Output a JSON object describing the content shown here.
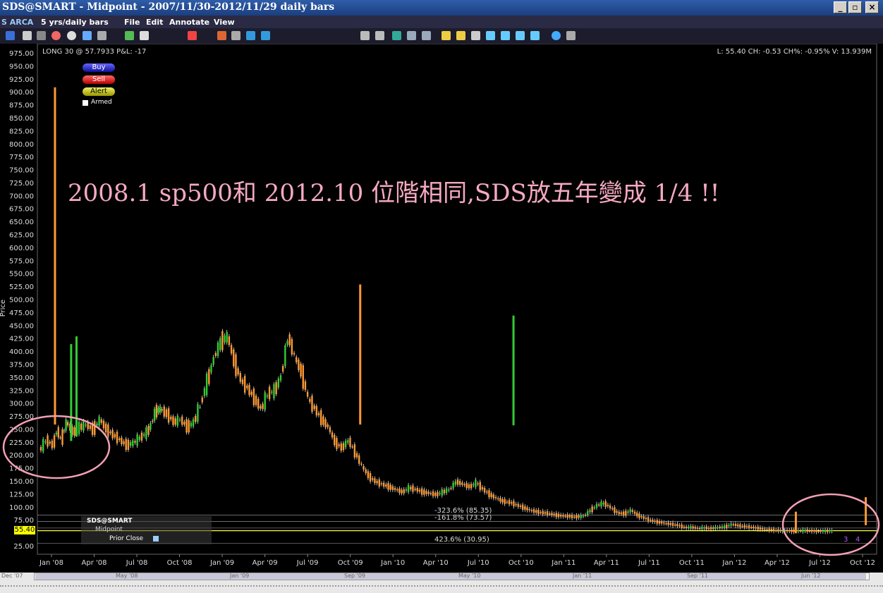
{
  "window": {
    "title": "SDS@SMART - Midpoint - 2007/11/30-2012/11/29 daily bars"
  },
  "menu": {
    "exchange": "S ARCA",
    "period": "5 yrs/daily bars",
    "items": [
      "File",
      "Edit",
      "Annotate",
      "View"
    ]
  },
  "header": {
    "position": "LONG 30 @ 57.7933 P&L: -17",
    "stats": "L: 55.40 CH: -0.53 CH%: -0.95% V: 13.939M"
  },
  "order_panel": {
    "buy": "Buy",
    "sell": "Sell",
    "alert": "Alert",
    "armed": "Armed"
  },
  "annotation": "2008.1 sp500和 2012.10 位階相同,SDS放五年變成 1/4 !!",
  "legend": {
    "symbol": "SDS@SMART",
    "midpoint": "Midpoint",
    "prior_close": "Prior Close"
  },
  "price_tag": "55.40",
  "fib_labels": [
    "-323.6% (85.35)",
    "-161.8% (73.57)",
    "423.6% (30.95)"
  ],
  "wave_labels": [
    "3",
    "4"
  ],
  "scroll_labels": [
    "Dec '07",
    "May '08",
    "Jan '09",
    "Sep '09",
    "May '10",
    "Jan '11",
    "Sep '11",
    "Jun '12"
  ],
  "colors": {
    "up": "#33cc33",
    "down": "#ff9933",
    "wick": "#ffffff",
    "circle": "#f2a0b4",
    "annotation": "#f5a9c0",
    "price_tag": "#ffff00"
  },
  "chart_data": {
    "type": "bar",
    "title": "SDS@SMART - Midpoint - 2007/11/30-2012/11/29 daily bars",
    "ylabel": "Price",
    "ylim": [
      25,
      975
    ],
    "yticks": [
      975,
      950,
      925,
      900,
      875,
      850,
      825,
      800,
      775,
      750,
      725,
      700,
      675,
      650,
      625,
      600,
      575,
      550,
      525,
      500,
      475,
      450,
      425,
      400,
      375,
      350,
      325,
      300,
      275,
      250,
      225,
      200,
      175,
      150,
      125,
      100,
      75,
      55.4,
      25
    ],
    "xtick_labels": [
      "Jan '08",
      "Apr '08",
      "Jul '08",
      "Oct '08",
      "Jan '09",
      "Apr '09",
      "Jul '09",
      "Oct '09",
      "Jan '10",
      "Apr '10",
      "Jul '10",
      "Oct '10",
      "Jan '11",
      "Apr '11",
      "Jul '11",
      "Oct '11",
      "Jan '12",
      "Apr '12",
      "Jul '12",
      "Oct '12"
    ],
    "x": [
      0,
      0.5,
      1,
      1.3,
      1.6,
      2,
      2.5,
      3,
      3.5,
      4,
      4.5,
      5,
      5.5,
      6,
      6.5,
      7,
      7.5,
      8,
      8.3,
      8.6,
      9,
      9.5,
      10,
      10.5,
      11,
      11.5,
      12,
      12.5,
      13,
      13.5,
      14,
      14.5,
      15,
      15.5,
      16,
      16.5,
      17,
      17.5,
      18,
      18.5,
      19,
      19.5,
      20,
      20.5,
      21,
      21.5,
      22,
      22.5,
      23,
      23.5,
      24,
      24.5,
      25,
      25.5,
      26,
      26.5,
      27,
      27.5,
      28,
      28.5,
      29,
      29.5,
      30,
      30.5,
      31,
      31.5,
      32,
      32.5,
      33,
      33.5,
      34,
      34.5,
      35,
      35.5,
      36,
      36.5,
      37,
      37.5,
      38,
      38.5,
      39,
      39.5,
      40,
      40.5,
      41,
      41.5,
      42,
      42.5,
      43,
      43.5,
      44,
      44.5,
      45,
      45.5,
      46,
      46.5,
      47,
      47.5,
      48,
      48.5,
      49,
      49.5,
      50,
      50.5,
      51,
      51.5,
      52,
      52.5,
      53,
      53.5,
      54,
      54.5,
      55,
      55.5,
      56,
      56.5,
      57,
      57.5,
      58,
      58.5,
      59,
      59.5,
      60
    ],
    "series": [
      {
        "values": [
          210,
          230,
          220,
          250,
          230,
          265,
          245,
          255,
          260,
          250,
          270,
          250,
          240,
          230,
          220,
          225,
          235,
          245,
          260,
          285,
          290,
          280,
          265,
          270,
          255,
          265,
          300,
          345,
          390,
          420,
          430,
          380,
          345,
          330,
          310,
          290,
          320,
          325,
          355,
          430,
          390,
          360,
          310,
          290,
          270,
          255,
          225,
          215,
          230,
          205,
          180,
          160,
          150,
          145,
          140,
          135,
          130,
          138,
          135,
          130,
          128,
          125,
          130,
          135,
          150,
          145,
          140,
          148,
          135,
          125,
          118,
          112,
          110,
          105,
          100,
          95,
          92,
          90,
          88,
          85,
          84,
          83,
          82,
          84,
          95,
          105,
          108,
          100,
          90,
          88,
          95,
          85,
          80,
          75,
          72,
          70,
          68,
          66,
          62,
          62,
          60,
          61,
          60,
          62,
          63,
          68,
          65,
          64,
          62,
          60,
          58,
          57,
          56,
          56,
          55,
          55.4,
          56,
          55,
          54.5,
          55,
          55.4
        ]
      }
    ],
    "spikes": [
      {
        "x": 1.1,
        "value": 910
      },
      {
        "x": 2.3,
        "value": 415
      },
      {
        "x": 2.7,
        "value": 430
      },
      {
        "x": 23.8,
        "value": 530
      },
      {
        "x": 35.2,
        "value": 470
      },
      {
        "x": 56.2,
        "value": 92
      },
      {
        "x": 61.4,
        "value": 120
      }
    ]
  }
}
